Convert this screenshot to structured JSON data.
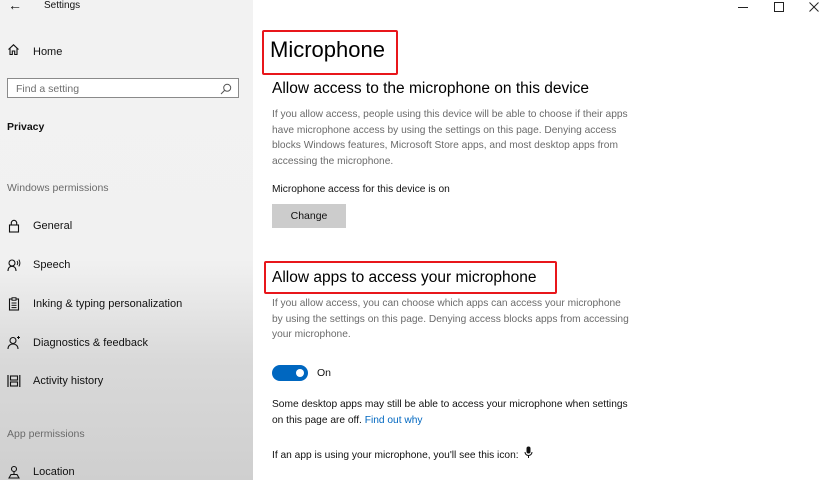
{
  "window": {
    "title": "Settings",
    "back_icon": "back-arrow-icon",
    "controls": [
      "minimize-icon",
      "maximize-icon",
      "close-icon"
    ]
  },
  "sidebar": {
    "home": {
      "label": "Home",
      "icon": "home-icon"
    },
    "search": {
      "placeholder": "Find a setting",
      "icon": "search-icon"
    },
    "section_title": "Privacy",
    "windows_permissions": {
      "header": "Windows permissions",
      "items": [
        {
          "label": "General",
          "icon": "lock-icon"
        },
        {
          "label": "Speech",
          "icon": "speech-icon"
        },
        {
          "label": "Inking & typing personalization",
          "icon": "clipboard-icon"
        },
        {
          "label": "Diagnostics & feedback",
          "icon": "diagnostics-icon"
        },
        {
          "label": "Activity history",
          "icon": "activity-history-icon"
        }
      ]
    },
    "app_permissions": {
      "header": "App permissions",
      "items": [
        {
          "label": "Location",
          "icon": "location-icon"
        }
      ]
    }
  },
  "main": {
    "page_title": "Microphone",
    "device_section": {
      "heading": "Allow access to the microphone on this device",
      "description": "If you allow access, people using this device will be able to choose if their apps have microphone access by using the settings on this page. Denying access blocks Windows features, Microsoft Store apps, and most desktop apps from accessing the microphone.",
      "status": "Microphone access for this device is on",
      "change_button": "Change"
    },
    "apps_section": {
      "heading": "Allow apps to access your microphone",
      "description": "If you allow access, you can choose which apps can access your microphone by using the settings on this page. Denying access blocks apps from accessing your microphone.",
      "toggle_state": "On",
      "toggle_on": true,
      "desktop_note": "Some desktop apps may still be able to access your microphone when settings on this page are off.",
      "find_out_link": "Find out why",
      "icon_note": "If an app is using your microphone, you'll see this icon:",
      "mic_icon": "microphone-icon"
    },
    "highlight_color": "#e8161b",
    "accent_color": "#0067c0"
  }
}
